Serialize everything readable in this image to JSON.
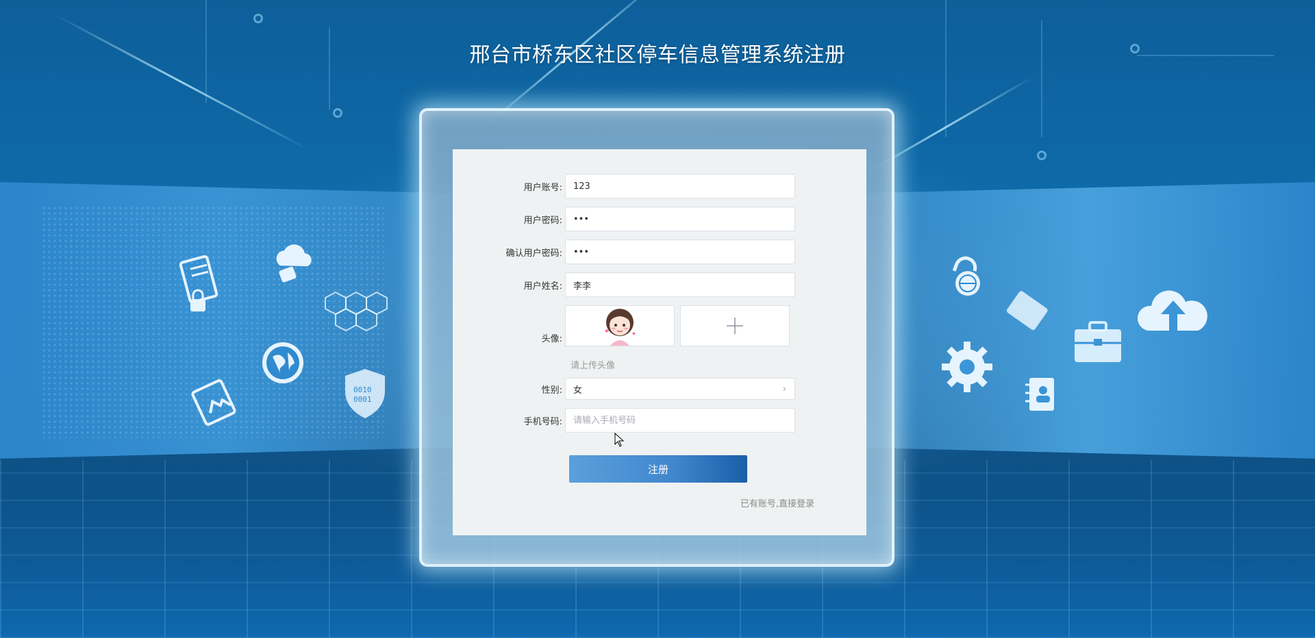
{
  "page": {
    "title": "邢台市桥东区社区停车信息管理系统注册"
  },
  "form": {
    "username": {
      "label": "用户账号:",
      "value": "123"
    },
    "password": {
      "label": "用户密码:",
      "value": "•••"
    },
    "confirm_password": {
      "label": "确认用户密码:",
      "value": "•••"
    },
    "realname": {
      "label": "用户姓名:",
      "value": "李李"
    },
    "avatar": {
      "label": "头像:",
      "hint": "请上传头像"
    },
    "gender": {
      "label": "性别:",
      "value": "女"
    },
    "phone": {
      "label": "手机号码:",
      "placeholder": "请输入手机号码",
      "value": ""
    },
    "submit_label": "注册",
    "login_link": "已有账号,直接登录"
  },
  "colors": {
    "background": "#0f5a92",
    "button": "#3f86cc",
    "card": "#eff2f2"
  },
  "icons": [
    "server-lock-icon",
    "cloud-lock-icon",
    "globe-icon",
    "hexagon-icon",
    "image-icon",
    "shield-binary-icon",
    "padlock-globe-icon",
    "folder-icon",
    "briefcase-icon",
    "cloud-upload-icon",
    "gear-icon",
    "contact-book-icon",
    "plus-icon",
    "chevron-right-icon",
    "cursor-icon"
  ]
}
